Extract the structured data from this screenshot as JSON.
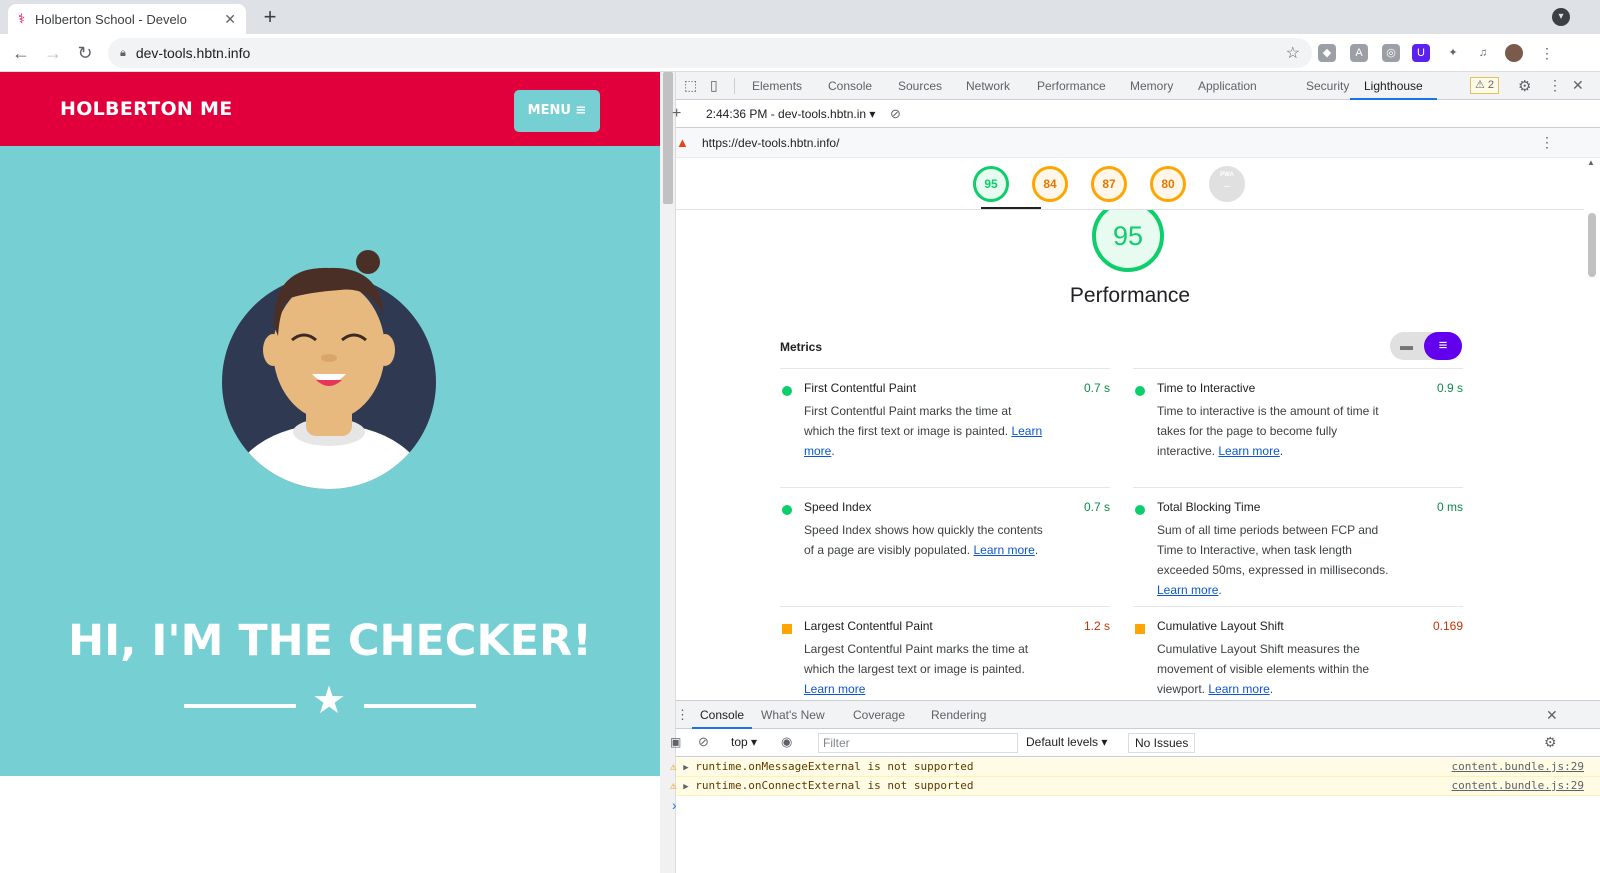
{
  "browser": {
    "tab_title": "Holberton School - Develo",
    "tab_close": "✕",
    "new_tab": "+",
    "url": "dev-tools.hbtn.info"
  },
  "site": {
    "brand": "HOLBERTON ME",
    "menu_label": "MENU ≡",
    "hero_title": "HI, I'M THE CHECKER!",
    "colors": {
      "header": "#e1003c",
      "hero": "#76d0d3"
    }
  },
  "devtools": {
    "tabs": [
      "Elements",
      "Console",
      "Sources",
      "Network",
      "Performance",
      "Memory",
      "Application",
      "Security",
      "Lighthouse"
    ],
    "active_tab": "Lighthouse",
    "warning_count": "⚠ 2",
    "lighthouse": {
      "report_select": "2:44:36 PM - dev-tools.hbtn.in ▾",
      "report_url": "https://dev-tools.hbtn.info/",
      "gauges": [
        {
          "score": "95",
          "status": "pass"
        },
        {
          "score": "84",
          "status": "average"
        },
        {
          "score": "87",
          "status": "average"
        },
        {
          "score": "80",
          "status": "average"
        },
        {
          "score": "PWA",
          "status": "na"
        }
      ],
      "main_score": "95",
      "category_title": "Performance",
      "metrics_heading": "Metrics",
      "learn_more": "Learn more",
      "metrics": [
        {
          "name": "First Contentful Paint",
          "value": "0.7 s",
          "status": "pass",
          "desc": "First Contentful Paint marks the time at which the first text or image is painted."
        },
        {
          "name": "Time to Interactive",
          "value": "0.9 s",
          "status": "pass",
          "desc": "Time to interactive is the amount of time it takes for the page to become fully interactive."
        },
        {
          "name": "Speed Index",
          "value": "0.7 s",
          "status": "pass",
          "desc": "Speed Index shows how quickly the contents of a page are visibly populated."
        },
        {
          "name": "Total Blocking Time",
          "value": "0 ms",
          "status": "pass",
          "desc": "Sum of all time periods between FCP and Time to Interactive, when task length exceeded 50ms, expressed in milliseconds."
        },
        {
          "name": "Largest Contentful Paint",
          "value": "1.2 s",
          "status": "average",
          "desc": "Largest Contentful Paint marks the time at which the largest text or image is painted."
        },
        {
          "name": "Cumulative Layout Shift",
          "value": "0.169",
          "status": "average",
          "desc": "Cumulative Layout Shift measures the movement of visible elements within the viewport."
        }
      ]
    },
    "drawer": {
      "tabs": [
        "Console",
        "What's New",
        "Coverage",
        "Rendering"
      ],
      "active_tab": "Console",
      "context": "top ▾",
      "filter_placeholder": "Filter",
      "levels": "Default levels ▾",
      "issues": "No Issues",
      "messages": [
        {
          "text": "runtime.onMessageExternal is not supported",
          "source": "content.bundle.js:29"
        },
        {
          "text": "runtime.onConnectExternal is not supported",
          "source": "content.bundle.js:29"
        }
      ],
      "prompt": "›"
    },
    "colors": {
      "pass": "#0cce6b",
      "average": "#ffa400",
      "accent": "#1a73e8"
    }
  }
}
